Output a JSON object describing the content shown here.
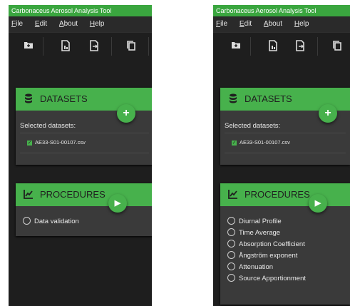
{
  "app": {
    "title": "Carbonaceus Aerosol Analysis Tool"
  },
  "menu": [
    "File",
    "Edit",
    "About",
    "Help"
  ],
  "toolbar": {
    "icons": [
      "folder-plus-icon",
      "file-chart-icon",
      "file-export-icon",
      "copy-icon"
    ]
  },
  "datasets": {
    "header": "DATASETS",
    "add_button": "+",
    "selected_label": "Selected datasets:",
    "items": [
      {
        "name": "AE33-S01-00107.csv",
        "checked": true
      }
    ]
  },
  "procedures": {
    "header": "PROCEDURES",
    "run_button": "▶",
    "left_options": [
      "Data validation"
    ],
    "right_options": [
      "Diurnal Profile",
      "Time Average",
      "Absorption Coefficient",
      "Ångström exponent",
      "Attenuation",
      "Source Apportionment"
    ]
  },
  "colors": {
    "accent": "#47b14c",
    "titlebar": "#3aa63f",
    "panel_bg": "#1e1e1e",
    "card_bg": "#3a3a3a"
  }
}
